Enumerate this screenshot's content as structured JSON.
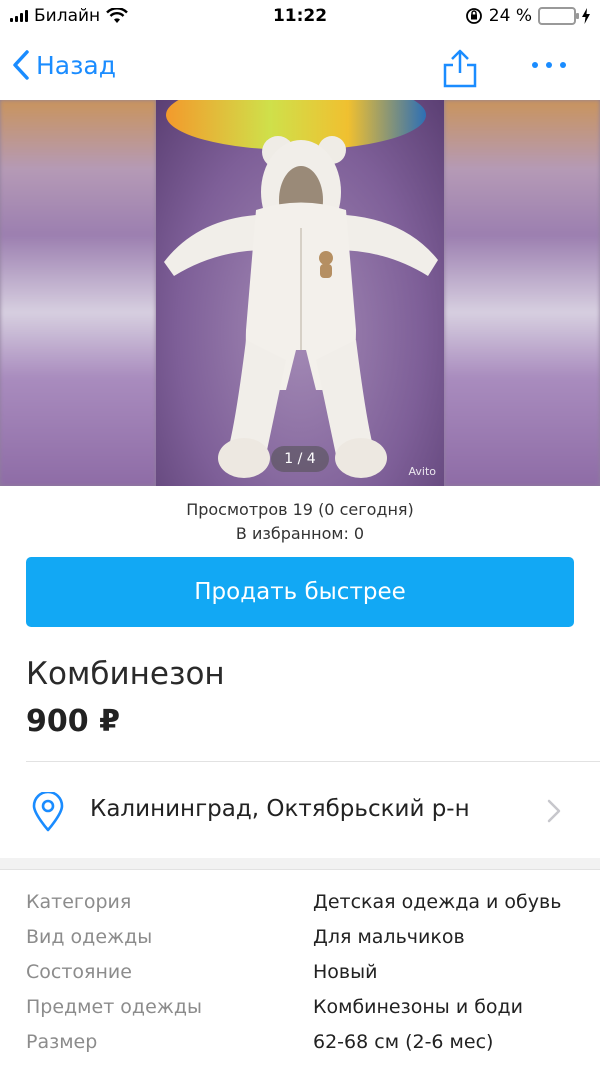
{
  "status_bar": {
    "carrier": "Билайн",
    "time": "11:22",
    "battery": "24 %",
    "battery_level": 0.24
  },
  "nav": {
    "back_label": "Назад"
  },
  "gallery": {
    "page_indicator": "1 / 4",
    "watermark": "Avito"
  },
  "stats": {
    "views": "Просмотров 19 (0 сегодня)",
    "favorites": "В избранном: 0"
  },
  "cta_label": "Продать быстрее",
  "listing": {
    "title": "Комбинезон",
    "price": "900 ₽",
    "location": "Калининград, Октябрьский р-н"
  },
  "params": [
    {
      "key": "Категория",
      "value": "Детская одежда и обувь"
    },
    {
      "key": "Вид одежды",
      "value": "Для мальчиков"
    },
    {
      "key": "Состояние",
      "value": "Новый"
    },
    {
      "key": "Предмет одежды",
      "value": "Комбинезоны и боди"
    },
    {
      "key": "Размер",
      "value": "62-68 см (2-6 мес)"
    }
  ],
  "colors": {
    "accent": "#1a8cff",
    "cta": "#12a8f4"
  }
}
